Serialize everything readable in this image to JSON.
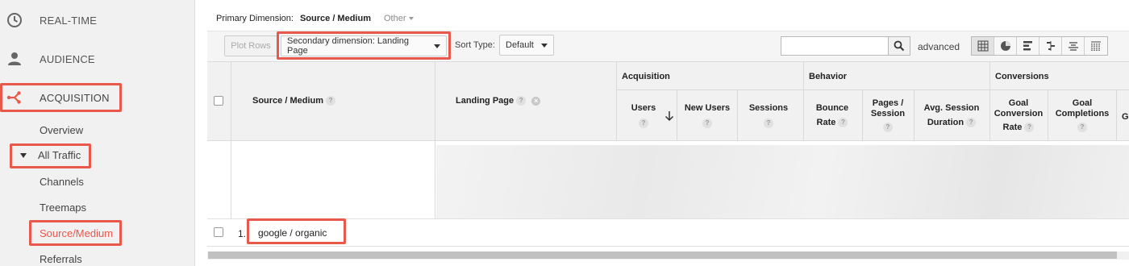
{
  "sidebar": {
    "items": [
      {
        "label": "REAL-TIME",
        "icon": "clock-icon"
      },
      {
        "label": "AUDIENCE",
        "icon": "person-icon"
      },
      {
        "label": "ACQUISITION",
        "icon": "acquisition-icon"
      }
    ],
    "sub_items": [
      {
        "label": "Overview"
      },
      {
        "label": "All Traffic"
      },
      {
        "label": "Channels"
      },
      {
        "label": "Treemaps"
      },
      {
        "label": "Source/Medium"
      },
      {
        "label": "Referrals"
      }
    ],
    "highlight_color": "#e8584b"
  },
  "primary_dimension": {
    "label": "Primary Dimension:",
    "value": "Source / Medium",
    "other": "Other"
  },
  "toolbar": {
    "plot_rows": "Plot Rows",
    "secondary_dimension": "Secondary dimension: Landing Page",
    "sort_type_label": "Sort Type:",
    "sort_type_value": "Default",
    "search_placeholder": "",
    "advanced": "advanced",
    "view_icons": [
      "grid-view-icon",
      "pie-view-icon",
      "bar-view-icon",
      "comparison-view-icon",
      "term-cloud-icon",
      "pivot-view-icon"
    ]
  },
  "table": {
    "dim1": "Source / Medium",
    "dim2": "Landing Page",
    "groups": {
      "acquisition": "Acquisition",
      "behavior": "Behavior",
      "conversions": "Conversions"
    },
    "columns": {
      "users": "Users",
      "new_users": "New Users",
      "sessions": "Sessions",
      "bounce_l1": "Bounce",
      "bounce_l2": "Rate",
      "pages_l1": "Pages /",
      "pages_l2": "Session",
      "avg_l1": "Avg. Session",
      "avg_l2": "Duration",
      "gcr_l1": "Goal",
      "gcr_l2": "Conversion",
      "gcr_l3": "Rate",
      "gc_l1": "Goal",
      "gc_l2": "Completions",
      "partial": "G"
    },
    "rows": [
      {
        "num": "1.",
        "source_medium": "google / organic"
      }
    ]
  }
}
